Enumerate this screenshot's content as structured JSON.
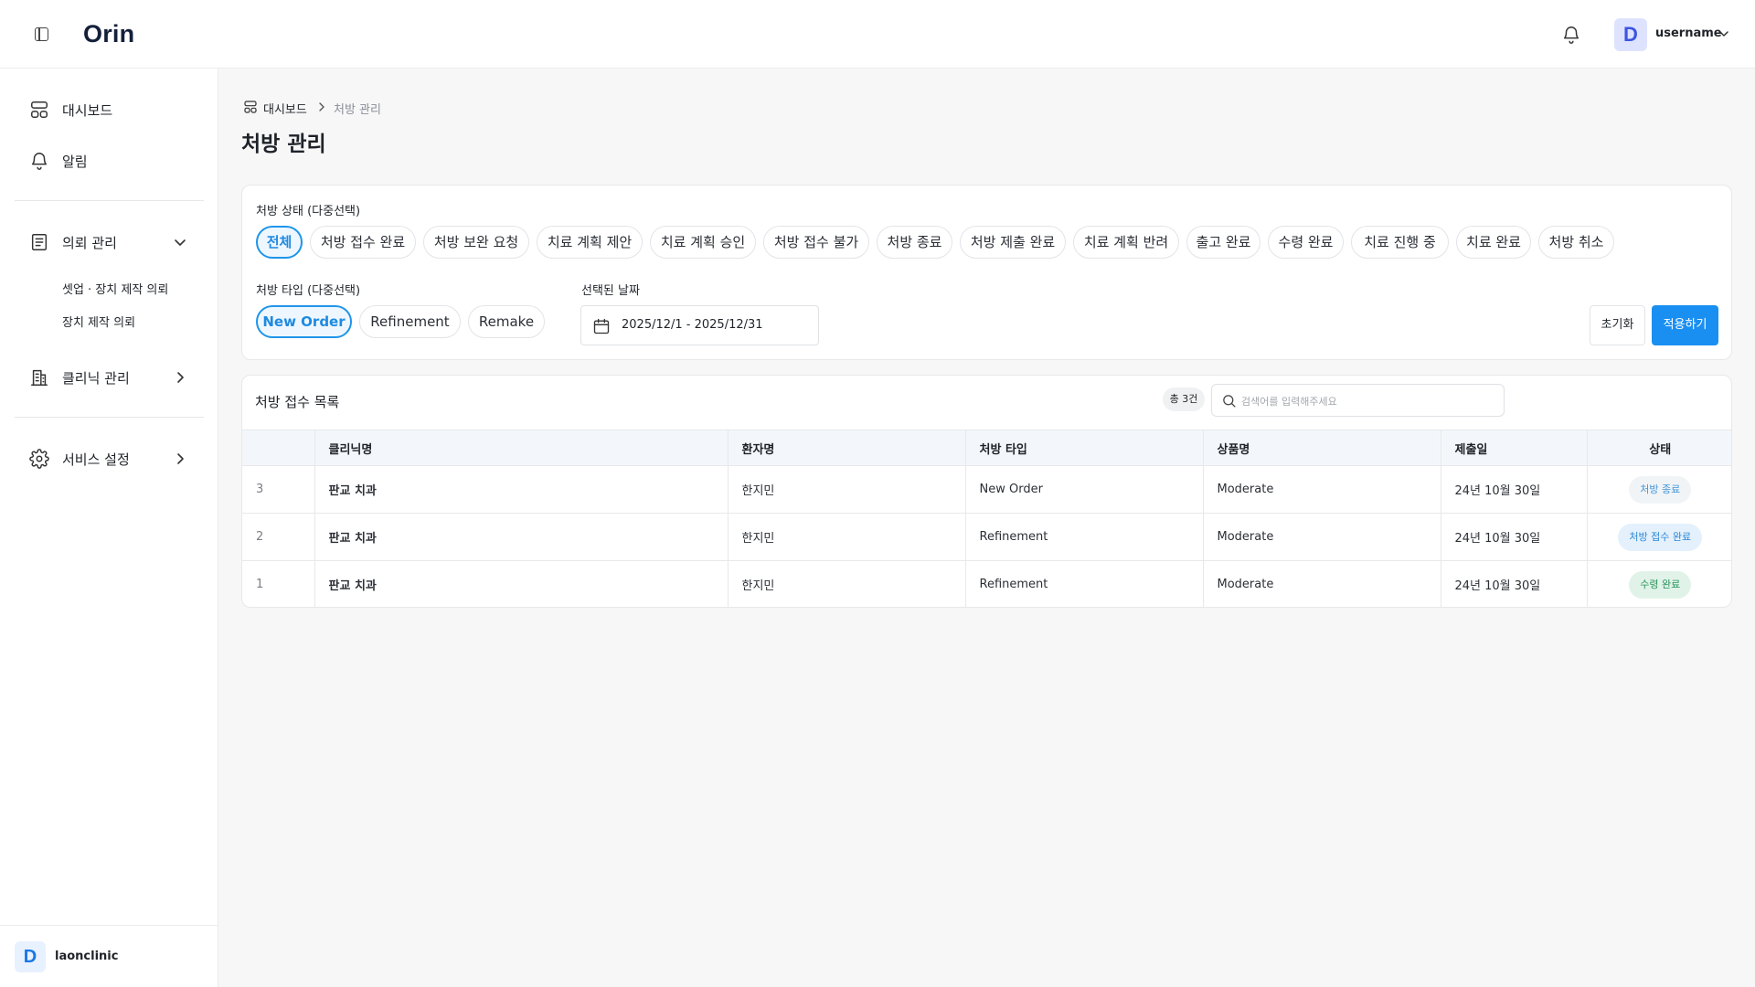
{
  "app": {
    "logo": "Orin"
  },
  "header": {
    "avatar_letter": "D",
    "username": "username"
  },
  "sidebar": {
    "dashboard": "대시보드",
    "alerts": "알림",
    "request_mgmt": "의뢰 관리",
    "sub_items": [
      "셋업 · 장치 제작 의뢰",
      "장치 제작 의뢰"
    ],
    "clinic_mgmt": "클리닉 관리",
    "service_settings": "서비스 설정",
    "footer": {
      "avatar_letter": "D",
      "clinic_name": "laonclinic"
    }
  },
  "breadcrumb": {
    "home": "대시보드",
    "current": "처방 관리"
  },
  "page_title": "처방 관리",
  "filters": {
    "status_label": "처방 상태 (다중선택)",
    "status_chips": [
      {
        "label": "전체",
        "active": true
      },
      {
        "label": "처방 접수 완료",
        "active": false
      },
      {
        "label": "처방 보완 요청",
        "active": false
      },
      {
        "label": "치료 계획 제안",
        "active": false
      },
      {
        "label": "치료 계획 승인",
        "active": false
      },
      {
        "label": "처방 접수 불가",
        "active": false
      },
      {
        "label": "처방 종료",
        "active": false
      },
      {
        "label": "처방 제출 완료",
        "active": false
      },
      {
        "label": "치료 계획 반려",
        "active": false
      },
      {
        "label": "출고 완료",
        "active": false
      },
      {
        "label": "수령 완료",
        "active": false
      },
      {
        "label": "치료 진행 중",
        "active": false
      },
      {
        "label": "치료 완료",
        "active": false
      },
      {
        "label": "처방 취소",
        "active": false
      }
    ],
    "type_label": "처방 타입 (다중선택)",
    "type_chips": [
      {
        "label": "New Order",
        "active": true
      },
      {
        "label": "Refinement",
        "active": false
      },
      {
        "label": "Remake",
        "active": false
      }
    ],
    "date_label": "선택된 날짜",
    "date_value": "2025/12/1 - 2025/12/31",
    "reset_label": "초기화",
    "apply_label": "적용하기"
  },
  "list": {
    "title": "처방 접수 목록",
    "count": "총 3건",
    "search_placeholder": "검색어를 입력해주세요",
    "columns": [
      "",
      "클리닉명",
      "환자명",
      "처방 타입",
      "상품명",
      "제출일",
      "상태"
    ],
    "rows": [
      {
        "no": "3",
        "clinic": "판교 치과",
        "patient": "한지민",
        "type": "New Order",
        "product": "Moderate",
        "date": "24년 10월 30일",
        "status": "처방 종료",
        "status_kind": "end"
      },
      {
        "no": "2",
        "clinic": "판교 치과",
        "patient": "한지민",
        "type": "Refinement",
        "product": "Moderate",
        "date": "24년 10월 30일",
        "status": "처방 접수 완료",
        "status_kind": "received"
      },
      {
        "no": "1",
        "clinic": "판교 치과",
        "patient": "한지민",
        "type": "Refinement",
        "product": "Moderate",
        "date": "24년 10월 30일",
        "status": "수령 완료",
        "status_kind": "delivered"
      }
    ]
  },
  "colors": {
    "accent": "#1a8ff2",
    "status_end_bg": "#f1f4f7",
    "status_end_fg": "#3f95d9",
    "status_received_bg": "#e4f1fc",
    "status_received_fg": "#2b86d6",
    "status_delivered_bg": "#e1f3e8",
    "status_delivered_fg": "#27915a"
  }
}
